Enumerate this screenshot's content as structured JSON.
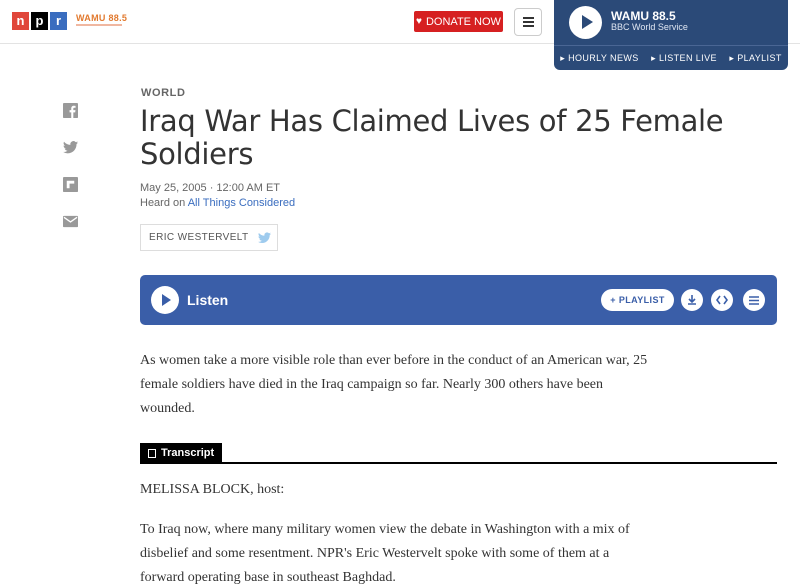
{
  "header": {
    "logo_letters": [
      "n",
      "p",
      "r"
    ],
    "station_logo": "WAMU 88.5",
    "donate_label": "DONATE NOW",
    "menu_icon": "hamburger-icon"
  },
  "player": {
    "station": "WAMU 88.5",
    "program": "BBC World Service",
    "links": [
      "HOURLY NEWS",
      "LISTEN LIVE",
      "PLAYLIST"
    ]
  },
  "social": [
    "facebook-icon",
    "twitter-icon",
    "flipboard-icon",
    "email-icon"
  ],
  "article": {
    "section": "WORLD",
    "title": "Iraq War Has Claimed Lives of 25 Female Soldiers",
    "dateline": "May 25, 2005 · 12:00 AM ET",
    "heard_prefix": "Heard on",
    "heard_program": "All Things Considered",
    "author": "ERIC WESTERVELT",
    "summary": "As women take a more visible role than ever before in the conduct of an American war, 25 female soldiers have died in the Iraq campaign so far. Nearly 300 others have been wounded."
  },
  "listen": {
    "label": "Listen",
    "playlist_label": "PLAYLIST",
    "actions": [
      "download-icon",
      "embed-icon",
      "transcript-icon"
    ]
  },
  "transcript": {
    "label": "Transcript",
    "speaker": "MELISSA BLOCK, host:",
    "paragraph": "To Iraq now, where many military women view the debate in Washington with a mix of disbelief and some resentment. NPR's Eric Westervelt spoke with some of them at a forward operating base in southeast Baghdad."
  },
  "colors": {
    "npr_red": "#e0463a",
    "npr_blue": "#3a6dbf",
    "donate": "#d62021",
    "player_bg": "#2b4a78",
    "listen_bg": "#3a5ea8"
  }
}
